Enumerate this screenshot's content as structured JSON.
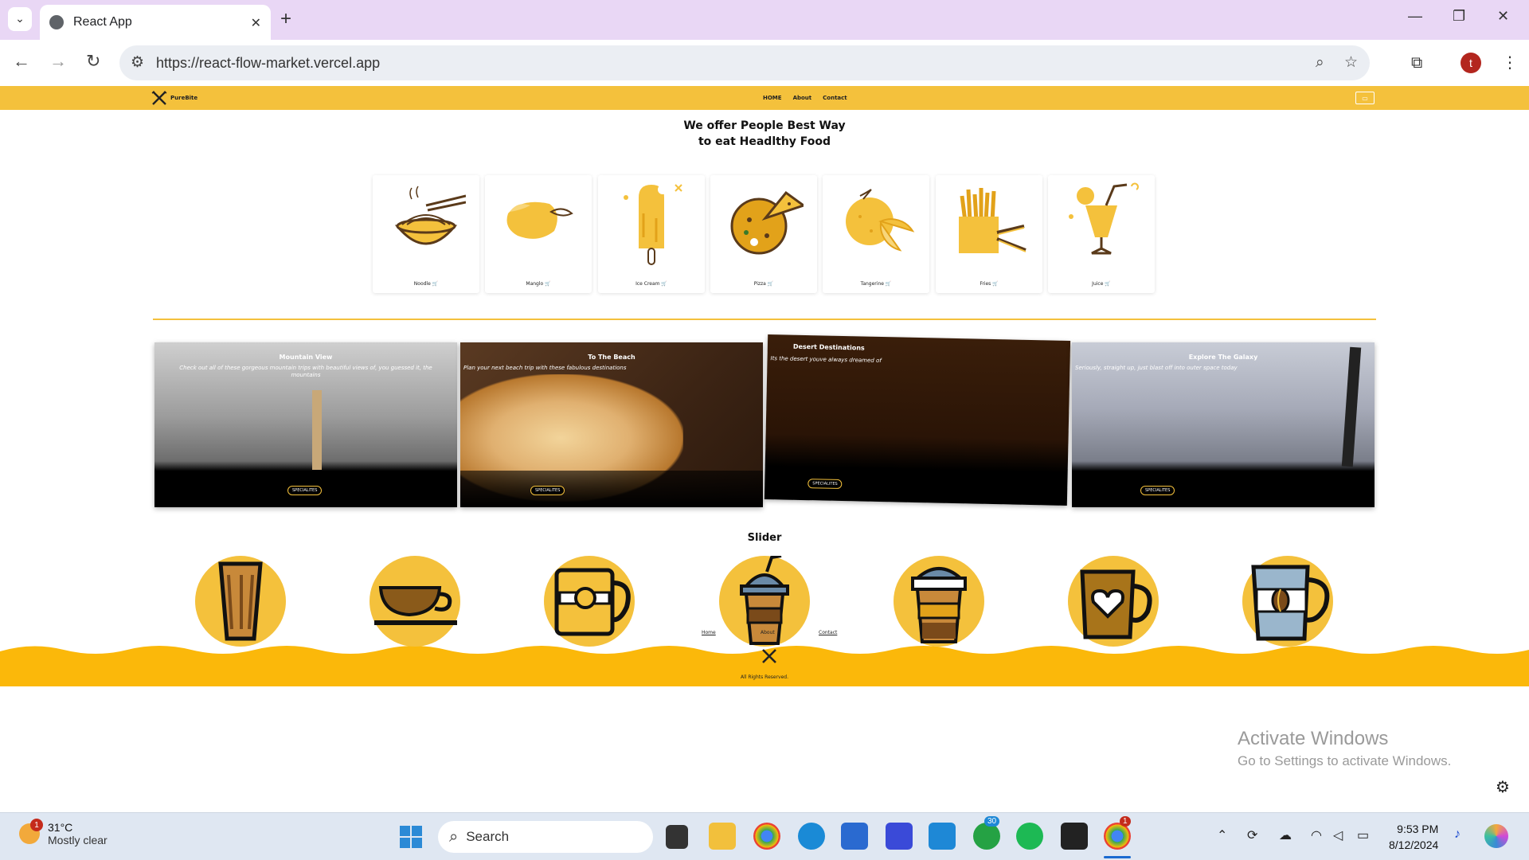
{
  "browser": {
    "tab_title": "React App",
    "url": "https://react-flow-market.vercel.app",
    "profile_initial": "t"
  },
  "site": {
    "brand": "PureBite",
    "nav": [
      "HOME",
      "About",
      "Contact"
    ],
    "hero_line1": "We offer People Best Way",
    "hero_line2": "to eat Headlthy Food",
    "foods": [
      "Noodle",
      "Manglo",
      "Ice Cream",
      "Pizza",
      "Tangerine",
      "Fries",
      "Juice"
    ],
    "promos": [
      {
        "title": "Mountain View",
        "desc": "Check out all of these gorgeous mountain trips with beautiful views of, you guessed it, the mountains",
        "button": "SPECIALITES"
      },
      {
        "title": "To The Beach",
        "desc": "Plan your next beach trip with these fabulous destinations",
        "button": "SPECIALITES"
      },
      {
        "title": "Desert Destinations",
        "desc": "Its the desert youve always dreamed of",
        "button": "SPECIALITES"
      },
      {
        "title": "Explore The Galaxy",
        "desc": "Seriously, straight up, just blast off into outer space today",
        "button": "SPECIALITES"
      }
    ],
    "slider_title": "Slider",
    "footer_links": [
      "Home",
      "About",
      "Contact"
    ],
    "footer_rights": "All Rights Reserved."
  },
  "overlay": {
    "activate_title": "Activate Windows",
    "activate_sub": "Go to Settings to activate Windows."
  },
  "taskbar": {
    "temp": "31°C",
    "weather": "Mostly clear",
    "weather_badge": "1",
    "search": "Search",
    "whatsapp_badge": "30",
    "chrome_badge": "1",
    "time": "9:53 PM",
    "date": "8/12/2024"
  },
  "colors": {
    "accent": "#f4c13c",
    "footer_wave": "#fbb80a"
  }
}
